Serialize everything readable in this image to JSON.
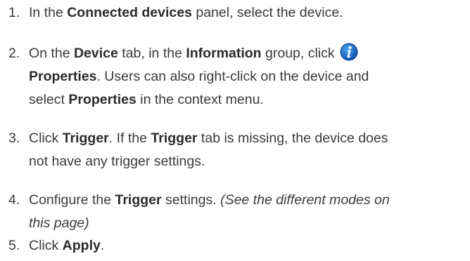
{
  "steps": [
    {
      "number": "1.",
      "parts": [
        "In the ",
        "Connected devices",
        " panel, select the device."
      ]
    },
    {
      "number": "2.",
      "parts": [
        "On the ",
        "Device",
        " tab, in the ",
        "Information",
        " group, click ",
        "Properties",
        ". Users can also right-click on the device and",
        "select ",
        "Properties",
        " in the context menu."
      ],
      "icon": "info-icon"
    },
    {
      "number": "3.",
      "parts": [
        "Click ",
        "Trigger",
        ". If the ",
        "Trigger",
        " tab is missing, the device does",
        "not have any trigger settings."
      ]
    },
    {
      "number": "4.",
      "parts": [
        "Configure the ",
        "Trigger",
        " settings. ",
        "(See the different modes on",
        "this page)"
      ]
    },
    {
      "number": "5.",
      "parts": [
        "Click ",
        "Apply",
        "."
      ]
    }
  ],
  "colors": {
    "text": "#3a3a3a",
    "icon": "#1565c0"
  }
}
